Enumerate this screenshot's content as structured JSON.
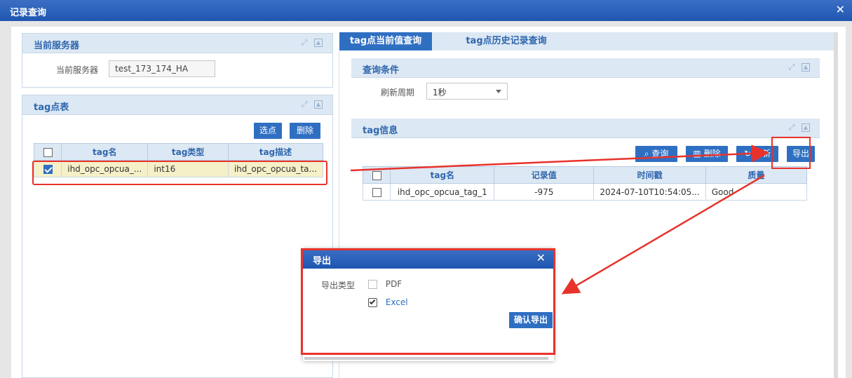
{
  "window": {
    "title": "记录查询",
    "close": "✕"
  },
  "server_panel": {
    "title": "当前服务器",
    "label": "当前服务器",
    "value": "test_173_174_HA"
  },
  "tag_table_panel": {
    "title": "tag点表",
    "select_button": "选点",
    "delete_button": "删除",
    "columns": [
      "tag名",
      "tag类型",
      "tag描述"
    ],
    "rows": [
      {
        "checked": true,
        "name": "ihd_opc_opcua_...",
        "type": "int16",
        "desc": "ihd_opc_opcua_ta..."
      }
    ]
  },
  "tabs": [
    {
      "label": "tag点当前值查询",
      "active": true
    },
    {
      "label": "tag点历史记录查询",
      "active": false
    }
  ],
  "query_panel": {
    "title": "查询条件",
    "refresh_label": "刷新周期",
    "refresh_value": "1秒"
  },
  "tag_info_panel": {
    "title": "tag信息",
    "query_button": "查询",
    "delete_button": "删除",
    "refresh_button": "刷新",
    "export_button": "导出",
    "columns": [
      "tag名",
      "记录值",
      "时间戳",
      "质量"
    ],
    "rows": [
      {
        "checked": false,
        "name": "ihd_opc_opcua_tag_1",
        "value": "-975",
        "timestamp": "2024-07-10T10:54:05...",
        "quality": "Good"
      }
    ]
  },
  "export_dialog": {
    "title": "导出",
    "type_label": "导出类型",
    "options": [
      {
        "label": "PDF",
        "checked": false
      },
      {
        "label": "Excel",
        "checked": true
      }
    ],
    "confirm_button": "确认导出"
  },
  "colors": {
    "accent": "#2f6fc2",
    "header_bg": "#dce8f4",
    "annotation": "#e8322b",
    "row_selected": "#f5f0c8"
  }
}
